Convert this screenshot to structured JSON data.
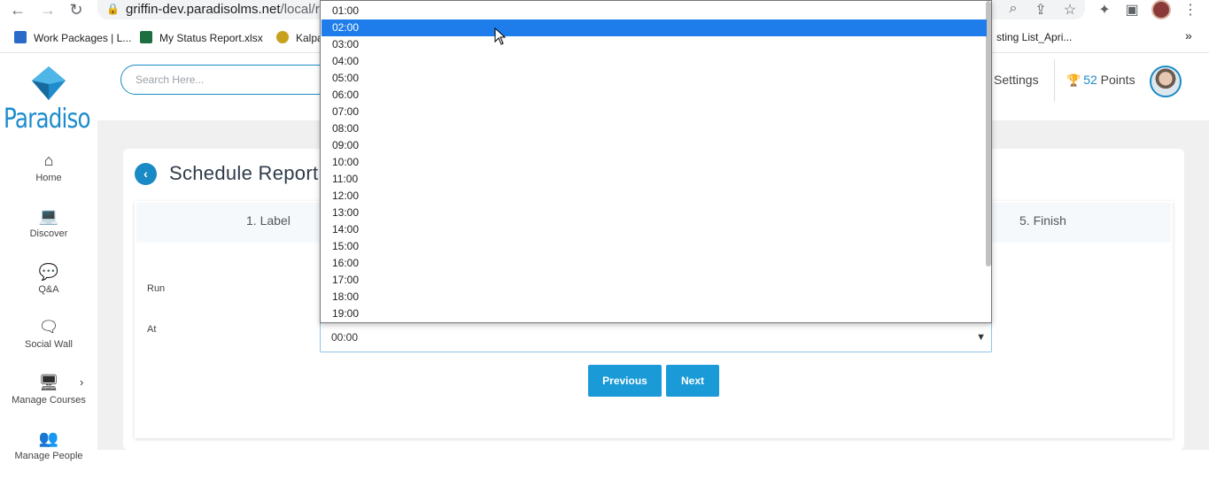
{
  "browser": {
    "url_host": "griffin-dev.paradisolms.net",
    "url_path": "/local/rep",
    "bookmarks": [
      "Work Packages | L...",
      "My Status Report.xlsx",
      "Kalpa",
      "sting List_Apri..."
    ],
    "bookmarks_more": "»"
  },
  "app": {
    "logo_text": "Paradiso",
    "sidebar": [
      {
        "label": "Home",
        "icon": "home-icon"
      },
      {
        "label": "Discover",
        "icon": "laptop-icon"
      },
      {
        "label": "Q&A",
        "icon": "chat-icon"
      },
      {
        "label": "Social Wall",
        "icon": "wechat-icon"
      },
      {
        "label": "Manage Courses",
        "icon": "monitor-icon"
      },
      {
        "label": "Manage People",
        "icon": "people-icon"
      }
    ],
    "search_placeholder": "Search Here...",
    "settings_label": "Settings",
    "points_value": "52",
    "points_label": "Points"
  },
  "page": {
    "title": "Schedule Report",
    "steps": [
      "1. Label",
      "5. Finish"
    ],
    "run_label": "Run",
    "at_label": "At",
    "at_value": "00:00",
    "previous_label": "Previous",
    "next_label": "Next"
  },
  "dropdown": {
    "options": [
      "01:00",
      "02:00",
      "03:00",
      "04:00",
      "05:00",
      "06:00",
      "07:00",
      "08:00",
      "09:00",
      "10:00",
      "11:00",
      "12:00",
      "13:00",
      "14:00",
      "15:00",
      "16:00",
      "17:00",
      "18:00",
      "19:00"
    ],
    "highlighted": "02:00"
  },
  "colors": {
    "accent": "#1a8ac6",
    "button": "#1a9ad6",
    "highlight": "#1e7dea"
  }
}
